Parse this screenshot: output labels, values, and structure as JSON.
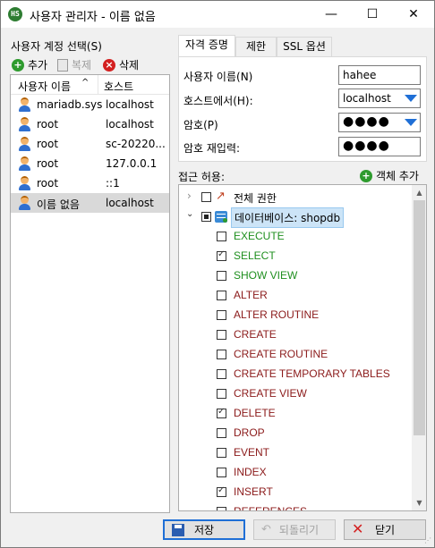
{
  "window": {
    "app_icon_text": "HS",
    "title": "사용자 관리자 - 이름 없음",
    "min_symbol": "—",
    "max_symbol": "☐",
    "close_symbol": "✕"
  },
  "accounts": {
    "section_label": "사용자 계정 선택(S)",
    "add_label": "추가",
    "clone_label": "복제",
    "delete_label": "삭제",
    "col_user": "사용자 이름",
    "col_host": "호스트",
    "sort_arrow": "^",
    "rows": [
      {
        "user": "mariadb.sys",
        "host": "localhost"
      },
      {
        "user": "root",
        "host": "localhost"
      },
      {
        "user": "root",
        "host": "sc-20220..."
      },
      {
        "user": "root",
        "host": "127.0.0.1"
      },
      {
        "user": "root",
        "host": "::1"
      },
      {
        "user": "이름 없음",
        "host": "localhost"
      }
    ]
  },
  "tabs": [
    {
      "label": "자격 증명"
    },
    {
      "label": "제한"
    },
    {
      "label": "SSL 옵션"
    }
  ],
  "credentials": {
    "username_label": "사용자 이름(N)",
    "username_value": "hahee",
    "host_label": "호스트에서(H):",
    "host_value": "localhost",
    "password_label": "암호(P)",
    "password_value": "●●●●",
    "repeat_label": "암호 재입력:",
    "repeat_value": "●●●●"
  },
  "access": {
    "label": "접근 허용:",
    "add_object_label": "객체 추가",
    "all_privs_label": "전체 권한",
    "db_label": "데이터베이스: shopdb",
    "privileges": [
      {
        "name": "EXECUTE",
        "checked": false,
        "color": "green"
      },
      {
        "name": "SELECT",
        "checked": true,
        "color": "green"
      },
      {
        "name": "SHOW VIEW",
        "checked": false,
        "color": "green"
      },
      {
        "name": "ALTER",
        "checked": false,
        "color": "red"
      },
      {
        "name": "ALTER ROUTINE",
        "checked": false,
        "color": "red"
      },
      {
        "name": "CREATE",
        "checked": false,
        "color": "red"
      },
      {
        "name": "CREATE ROUTINE",
        "checked": false,
        "color": "red"
      },
      {
        "name": "CREATE TEMPORARY TABLES",
        "checked": false,
        "color": "red"
      },
      {
        "name": "CREATE VIEW",
        "checked": false,
        "color": "red"
      },
      {
        "name": "DELETE",
        "checked": true,
        "color": "red"
      },
      {
        "name": "DROP",
        "checked": false,
        "color": "red"
      },
      {
        "name": "EVENT",
        "checked": false,
        "color": "red"
      },
      {
        "name": "INDEX",
        "checked": false,
        "color": "red"
      },
      {
        "name": "INSERT",
        "checked": true,
        "color": "red"
      },
      {
        "name": "REFERENCES",
        "checked": false,
        "color": "red"
      }
    ],
    "colors": {
      "green": "#1f8f1f",
      "red": "#8b1a1a"
    }
  },
  "buttons": {
    "save_label": "저장",
    "revert_label": "되돌리기",
    "close_label": "닫기"
  }
}
